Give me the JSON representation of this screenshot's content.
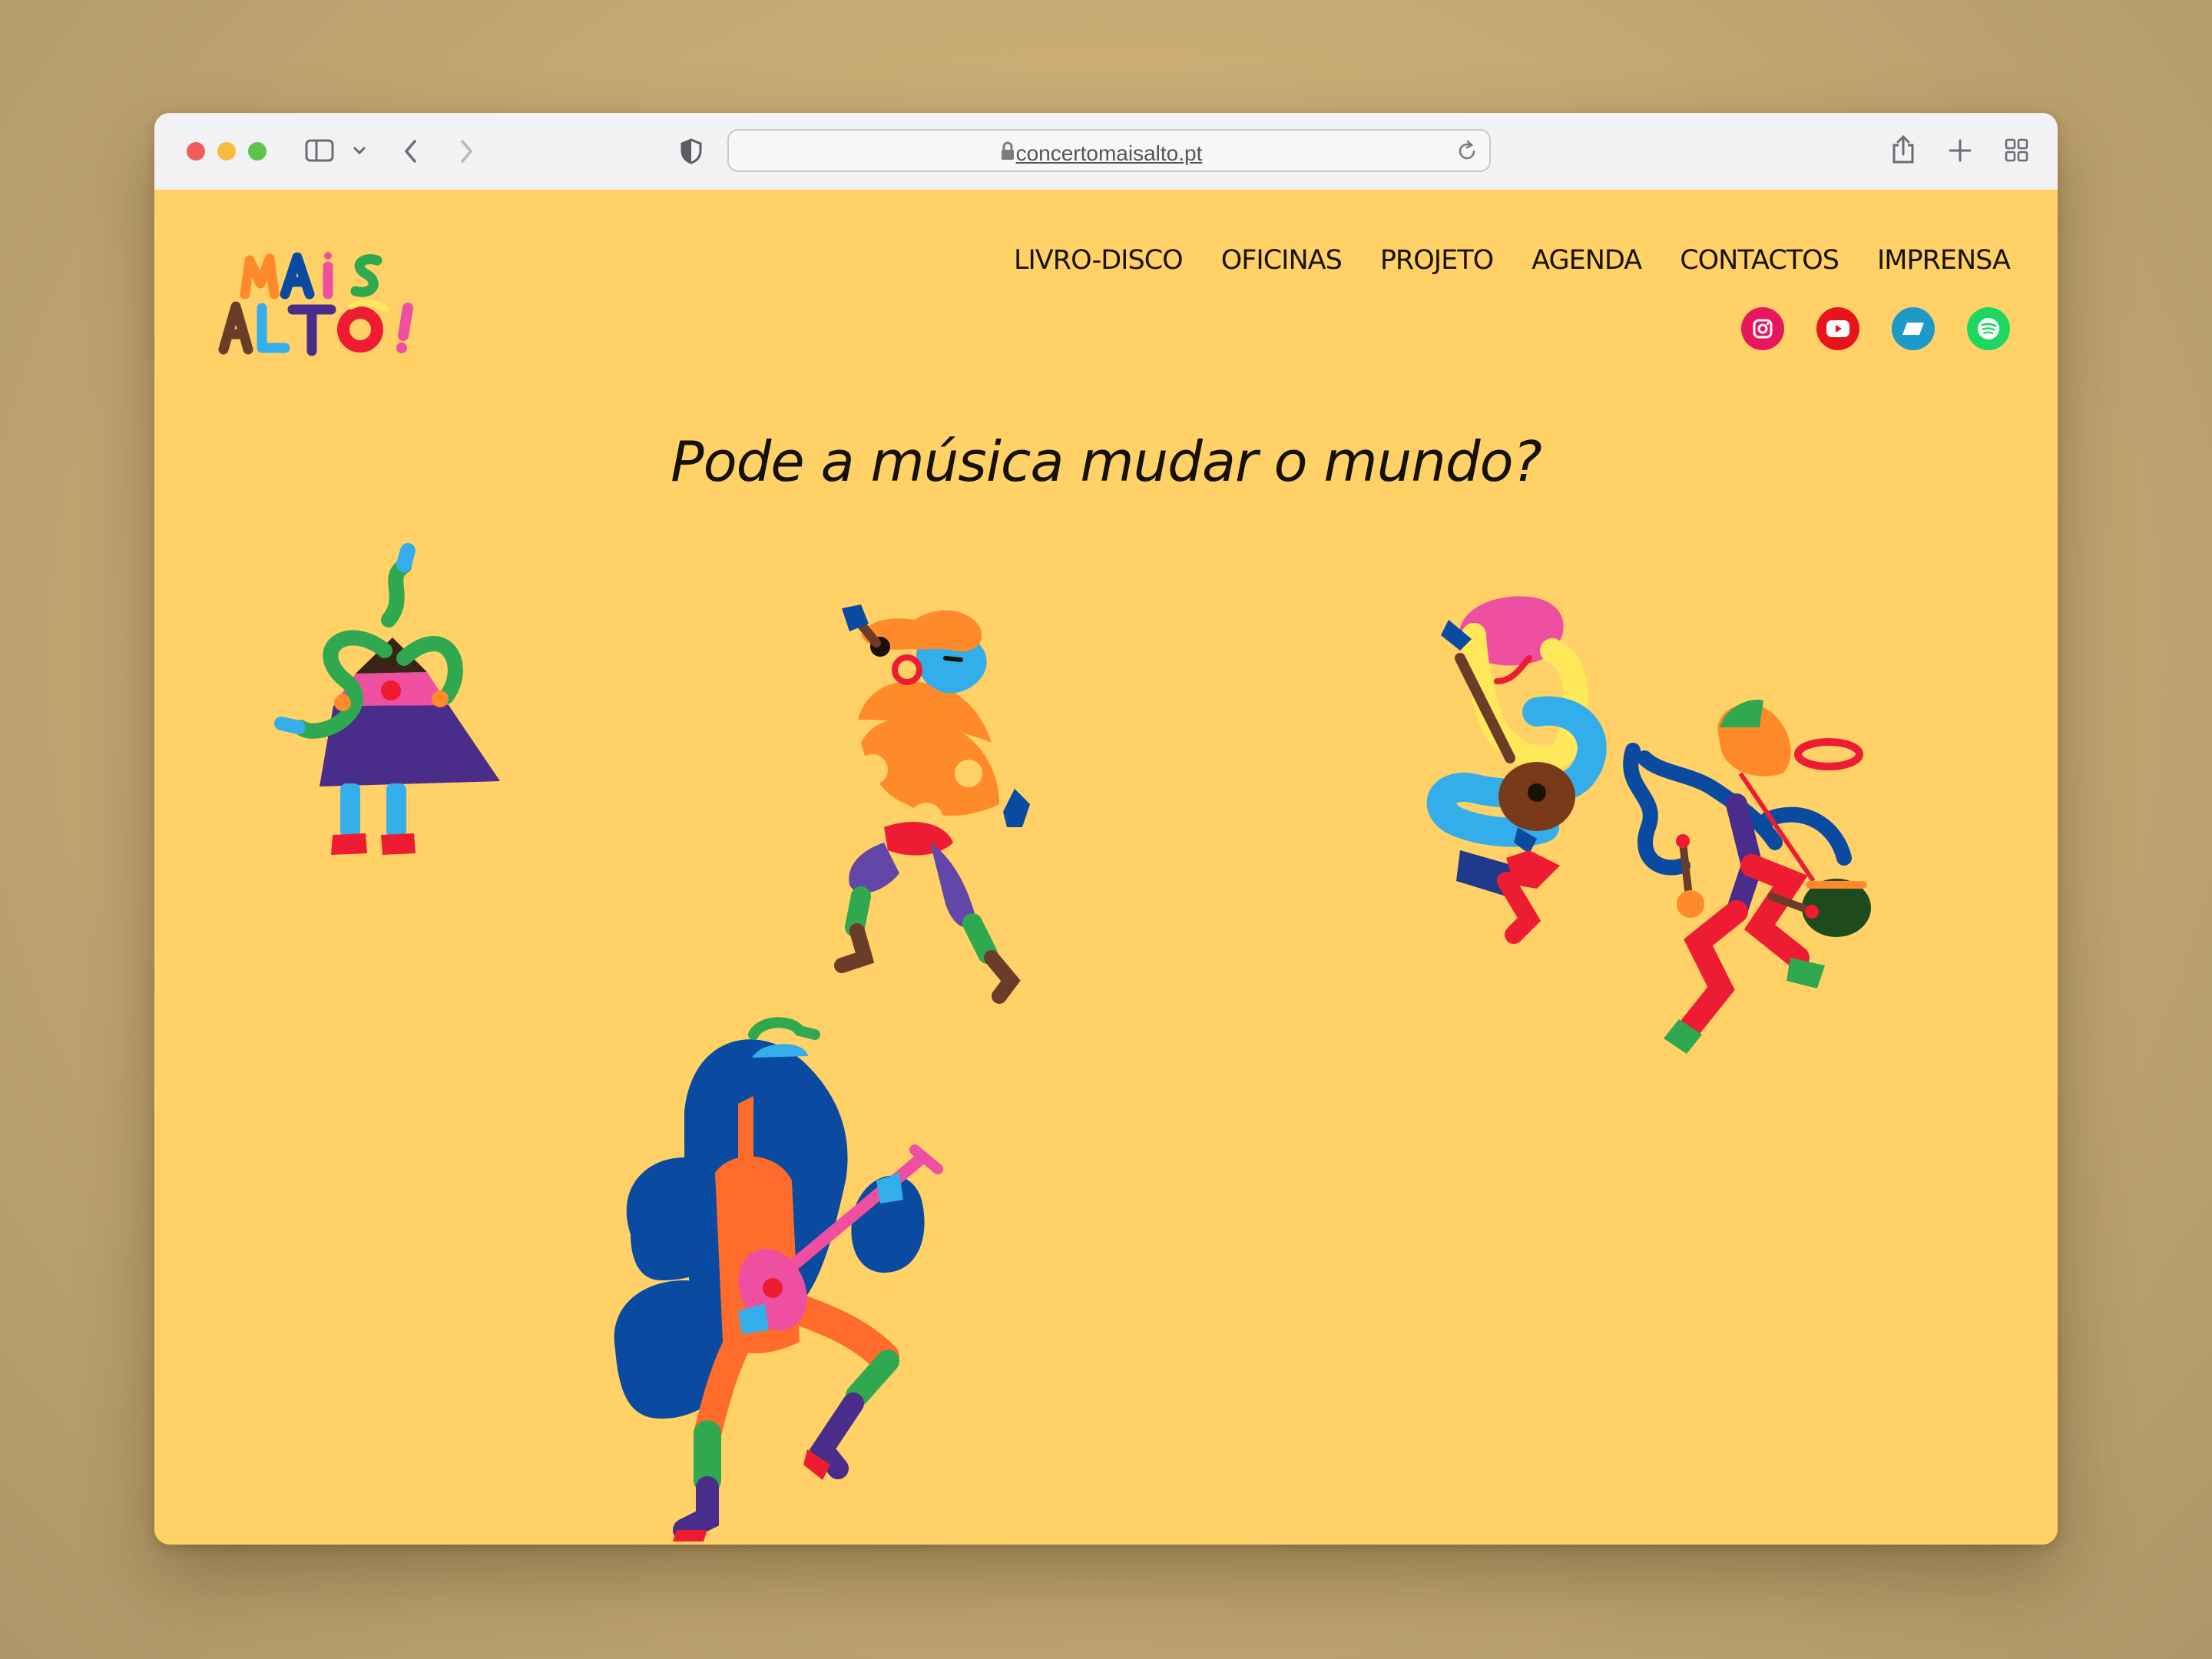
{
  "browser": {
    "url": "concertomaisalto.pt",
    "icons": [
      "close-dot",
      "minimize-dot",
      "zoom-dot",
      "sidebar-icon",
      "chevron-down-icon",
      "back-icon",
      "forward-icon",
      "shield-icon",
      "lock-icon",
      "reload-icon",
      "share-icon",
      "new-tab-icon",
      "tab-overview-icon"
    ]
  },
  "site": {
    "logo_text": "MAIS ALTO!",
    "nav": [
      "LIVRO-DISCO",
      "OFICINAS",
      "PROJETO",
      "AGENDA",
      "CONTACTOS",
      "IMPRENSA"
    ],
    "social": [
      {
        "name": "instagram",
        "color": "#e8175d"
      },
      {
        "name": "youtube",
        "color": "#e8141b"
      },
      {
        "name": "bandcamp",
        "color": "#1e9ac8"
      },
      {
        "name": "spotify",
        "color": "#1ed760"
      }
    ],
    "headline": "Pode a música mudar o mundo?"
  },
  "colors": {
    "page_bg": "#ffd166",
    "text": "#151008",
    "purple": "#4a2d8a",
    "blue": "#0a4aa0",
    "orange": "#ff8a2a",
    "pink": "#ef4fa0",
    "red": "#ee1c32",
    "green": "#2fa84f",
    "light_blue": "#34aeea",
    "yellow": "#ffe95a"
  }
}
